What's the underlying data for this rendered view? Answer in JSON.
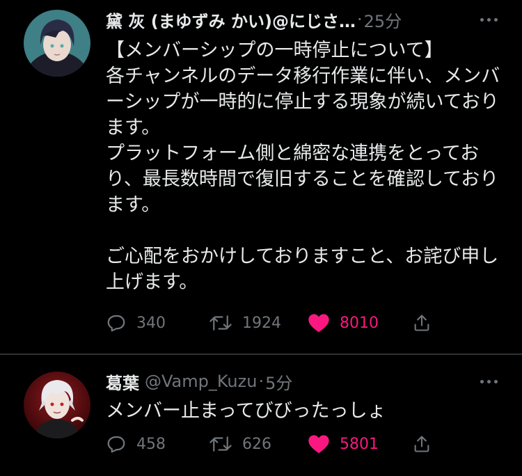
{
  "tweets": [
    {
      "author_name": "黛 灰 (まゆずみ かい)@にじさ…",
      "handle": "",
      "dot": "·",
      "time": "25分",
      "text": "【メンバーシップの一時停止について】\n各チャンネルのデータ移行作業に伴い、メンバーシップが一時的に停止する現象が続いております。\nプラットフォーム側と綿密な連携をとっており、最長数時間で復旧することを確認しております。\n\nご心配をおかけしておりますこと、お詫び申し上げます。",
      "replies": "340",
      "retweets": "1924",
      "likes": "8010",
      "liked": true
    },
    {
      "author_name": "葛葉",
      "handle": "@Vamp_Kuzu",
      "dot": "·",
      "time": "5分",
      "text": "メンバー止まってびびったっしょ",
      "replies": "458",
      "retweets": "626",
      "likes": "5801",
      "liked": true
    }
  ],
  "icons": {
    "reply": "reply-icon",
    "retweet": "retweet-icon",
    "like": "heart-icon",
    "share": "share-icon",
    "more": "more-options-icon"
  },
  "colors": {
    "background": "#000000",
    "text": "#e7e9ea",
    "muted": "#71767b",
    "like": "#f91880",
    "divider": "#2f3336"
  }
}
